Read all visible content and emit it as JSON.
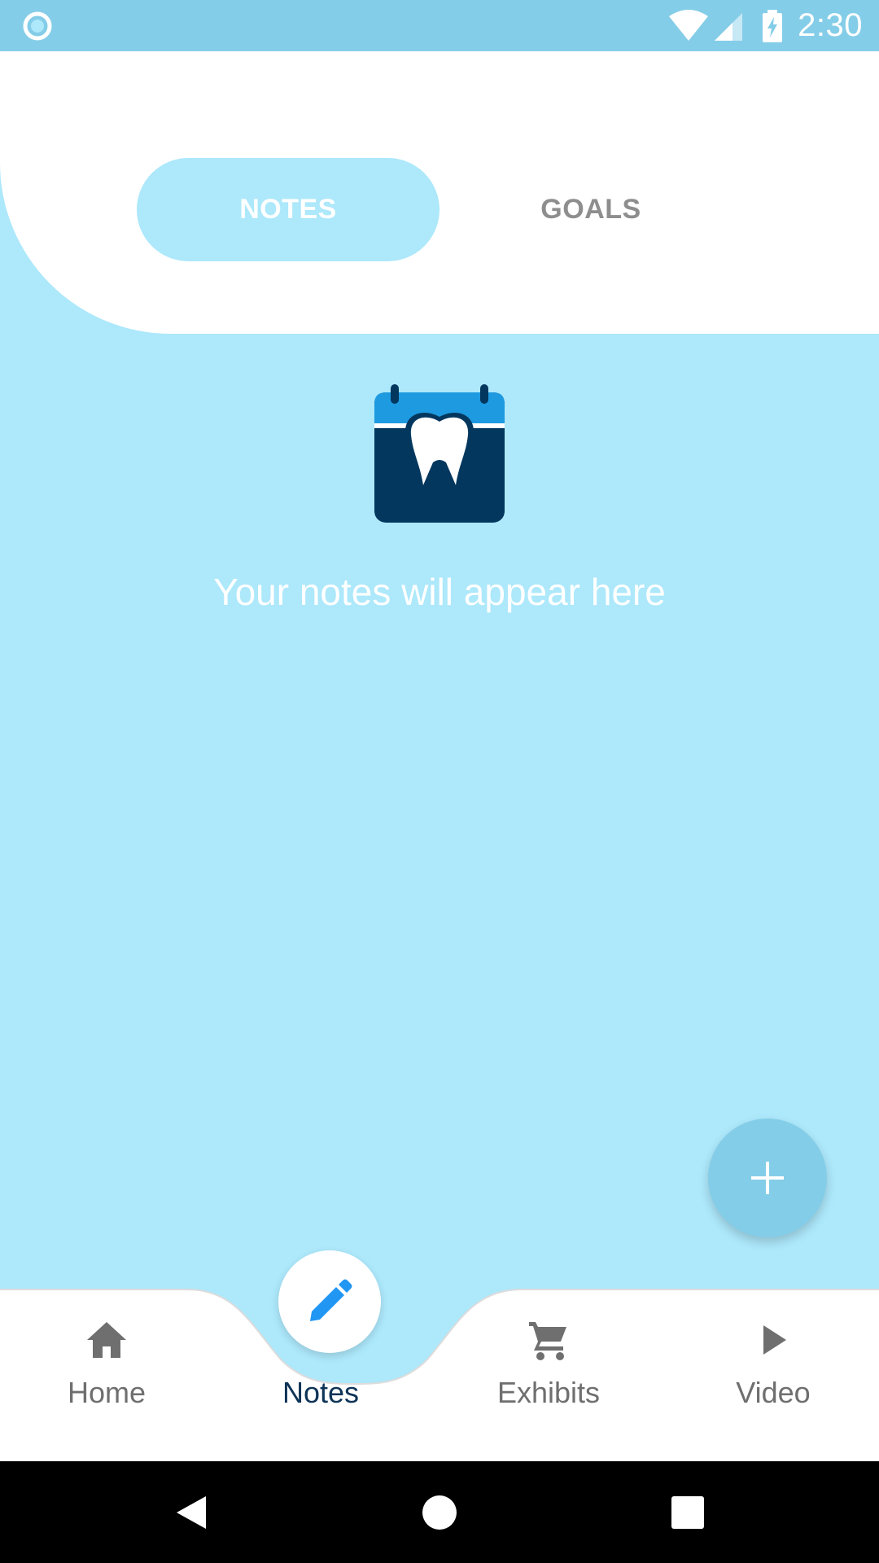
{
  "status_bar": {
    "time": "2:30",
    "icons": [
      "app-indicator-icon",
      "wifi-icon",
      "signal-icon",
      "battery-charging-icon"
    ]
  },
  "tabs": [
    {
      "label": "NOTES",
      "active": true
    },
    {
      "label": "GOALS",
      "active": false
    }
  ],
  "empty_state": {
    "icon": "tooth-calendar-icon",
    "message": "Your notes will appear here"
  },
  "fab": {
    "icon": "plus-icon"
  },
  "bottom_nav": [
    {
      "label": "Home",
      "icon": "home-icon",
      "active": false
    },
    {
      "label": "Notes",
      "icon": "pencil-icon",
      "active": true
    },
    {
      "label": "Exhibits",
      "icon": "cart-icon",
      "active": false
    },
    {
      "label": "Video",
      "icon": "play-icon",
      "active": false
    }
  ],
  "system_nav": [
    "back-icon",
    "home-circle-icon",
    "recents-icon"
  ],
  "colors": {
    "background": "#ade8fb",
    "status_bar": "#84cde8",
    "fab": "#84cde8",
    "active_nav_label": "#0e3457",
    "icon_dark": "#03375e",
    "icon_light": "#1e9ae0",
    "pencil": "#2196f3"
  }
}
